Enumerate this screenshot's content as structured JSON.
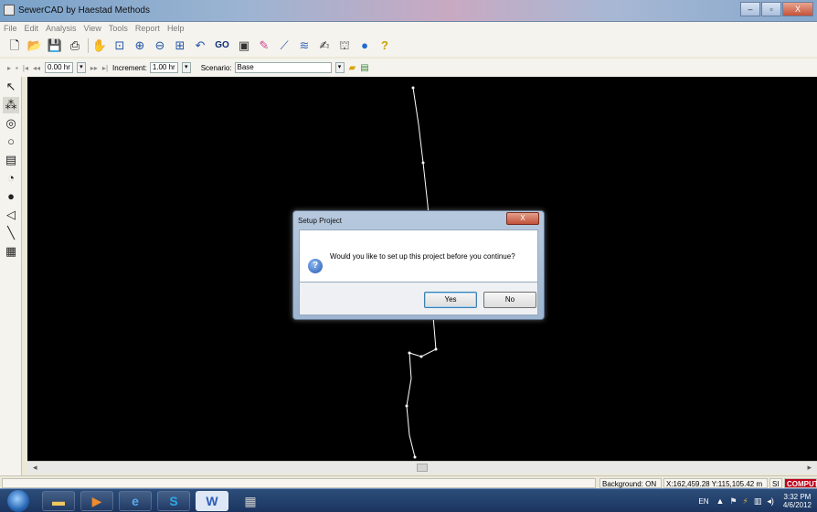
{
  "window": {
    "title": "SewerCAD by Haestad Methods",
    "controls": {
      "minimize": "–",
      "maximize": "▫",
      "close": "X"
    }
  },
  "menu": [
    "File",
    "Edit",
    "Analysis",
    "View",
    "Tools",
    "Report",
    "Help"
  ],
  "toolbar_main": {
    "go_label": "GO"
  },
  "toolbar_time": {
    "time_value": "0.00 hr",
    "increment_label": "Increment:",
    "increment_value": "1.00 hr",
    "scenario_label": "Scenario:",
    "scenario_value": "Base"
  },
  "statusbar": {
    "background": "Background: ON",
    "coords": "X:162,459.28  Y:115,105.42 m",
    "units": "SI",
    "compute": "COMPUTE",
    "compute_color": "#c0001a"
  },
  "dialog": {
    "title": "Setup Project",
    "close_glyph": "X",
    "message": "Would you like to set up this project before you continue?",
    "yes_label": "Yes",
    "no_label": "No",
    "icon_glyph": "?"
  },
  "taskbar": {
    "lang": "EN",
    "time": "3:32 PM",
    "date": "4/6/2012"
  },
  "colors": {
    "canvas": "#000000",
    "pipe": "#ffffff",
    "title_gradient": "#9cb4d2",
    "taskbar": "#1c3560"
  },
  "icons": {
    "palette": [
      "select-arrow-icon",
      "manhole-cluster-icon",
      "manhole-icon",
      "node-icon",
      "inlet-icon",
      "pump-icon",
      "junction-icon",
      "outlet-icon",
      "pipe-icon",
      "table-icon"
    ],
    "toolbar": [
      "new-file-icon",
      "open-folder-icon",
      "save-icon",
      "print-preview-icon",
      "pan-hand-icon",
      "zoom-window-icon",
      "zoom-in-icon",
      "zoom-out-icon",
      "zoom-extents-icon",
      "zoom-previous-icon",
      "go-icon",
      "flextable-icon",
      "color-coding-icon",
      "profile-icon",
      "graph-icon",
      "annotation-icon",
      "element-symbology-icon",
      "scenario-globe-icon",
      "help-icon"
    ]
  }
}
